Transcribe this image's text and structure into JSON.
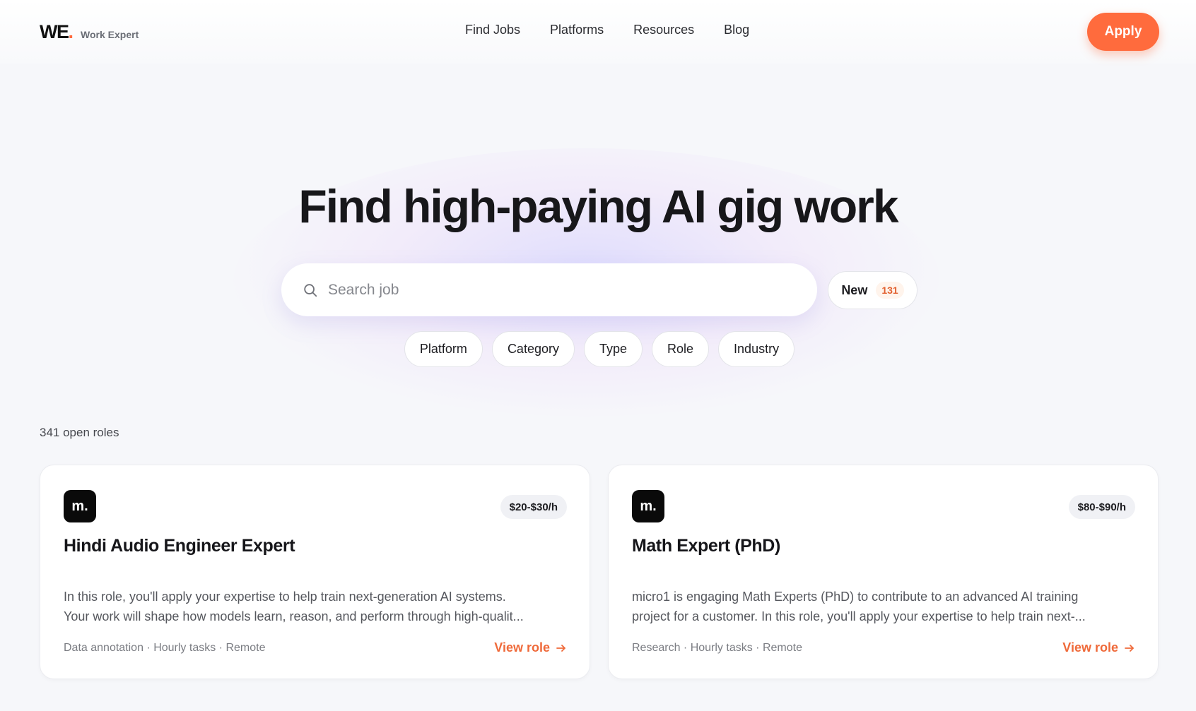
{
  "header": {
    "logo_mark": "WE",
    "logo_dot": ".",
    "logo_sub": "Work Expert",
    "nav": [
      "Find Jobs",
      "Platforms",
      "Resources",
      "Blog"
    ],
    "apply_label": "Apply"
  },
  "hero": {
    "title": "Find high-paying AI gig work",
    "search_placeholder": "Search job",
    "new_label": "New",
    "new_count": "131",
    "filters": [
      "Platform",
      "Category",
      "Type",
      "Role",
      "Industry"
    ]
  },
  "results": {
    "count_label": "341 open roles",
    "jobs": [
      {
        "logo": "m.",
        "pay": "$20-$30/h",
        "title": "Hindi Audio Engineer Expert",
        "desc_line1": "In this role, you'll apply your expertise to help train next-generation AI systems.",
        "desc_line2": "Your work will shape how models learn, reason, and perform through high-qualit...",
        "meta": "Data annotation · Hourly tasks · Remote",
        "link": "View role"
      },
      {
        "logo": "m.",
        "pay": "$80-$90/h",
        "title": "Math Expert (PhD)",
        "desc_line1": "micro1 is engaging Math Experts (PhD) to contribute to an advanced AI training",
        "desc_line2": "project for a customer. In this role, you'll apply your expertise to help train next-...",
        "meta": "Research · Hourly tasks · Remote",
        "link": "View role"
      }
    ]
  },
  "colors": {
    "accent": "#ff6b3d",
    "background": "#f6f7fa",
    "card": "#ffffff"
  },
  "icons": {
    "search": "search-icon",
    "arrow": "arrow-right-icon"
  }
}
